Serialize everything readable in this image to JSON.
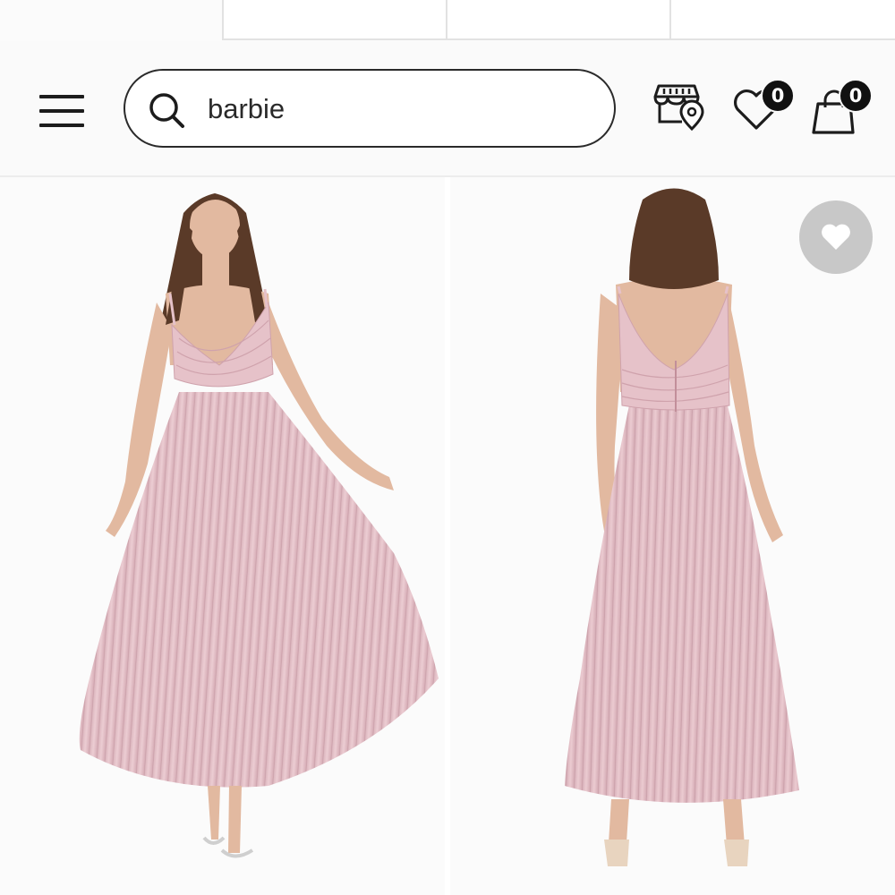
{
  "header": {
    "search": {
      "value": "barbie",
      "placeholder": ""
    },
    "icons": [
      "menu-icon",
      "search-icon",
      "store-locator-icon",
      "wishlist-icon",
      "shopping-bag-icon"
    ],
    "wishlist_count": "0",
    "bag_count": "0"
  },
  "products": [
    {
      "image": "pink-pleated-maxi-dress-front",
      "view": "front"
    },
    {
      "image": "pink-pleated-maxi-dress-back",
      "view": "back"
    }
  ],
  "colors": {
    "dress": "#e6c6cc",
    "hair": "#5a3a28",
    "skin": "#e2b9a0",
    "fav_button": "#c8c8c8",
    "badge": "#111111"
  }
}
